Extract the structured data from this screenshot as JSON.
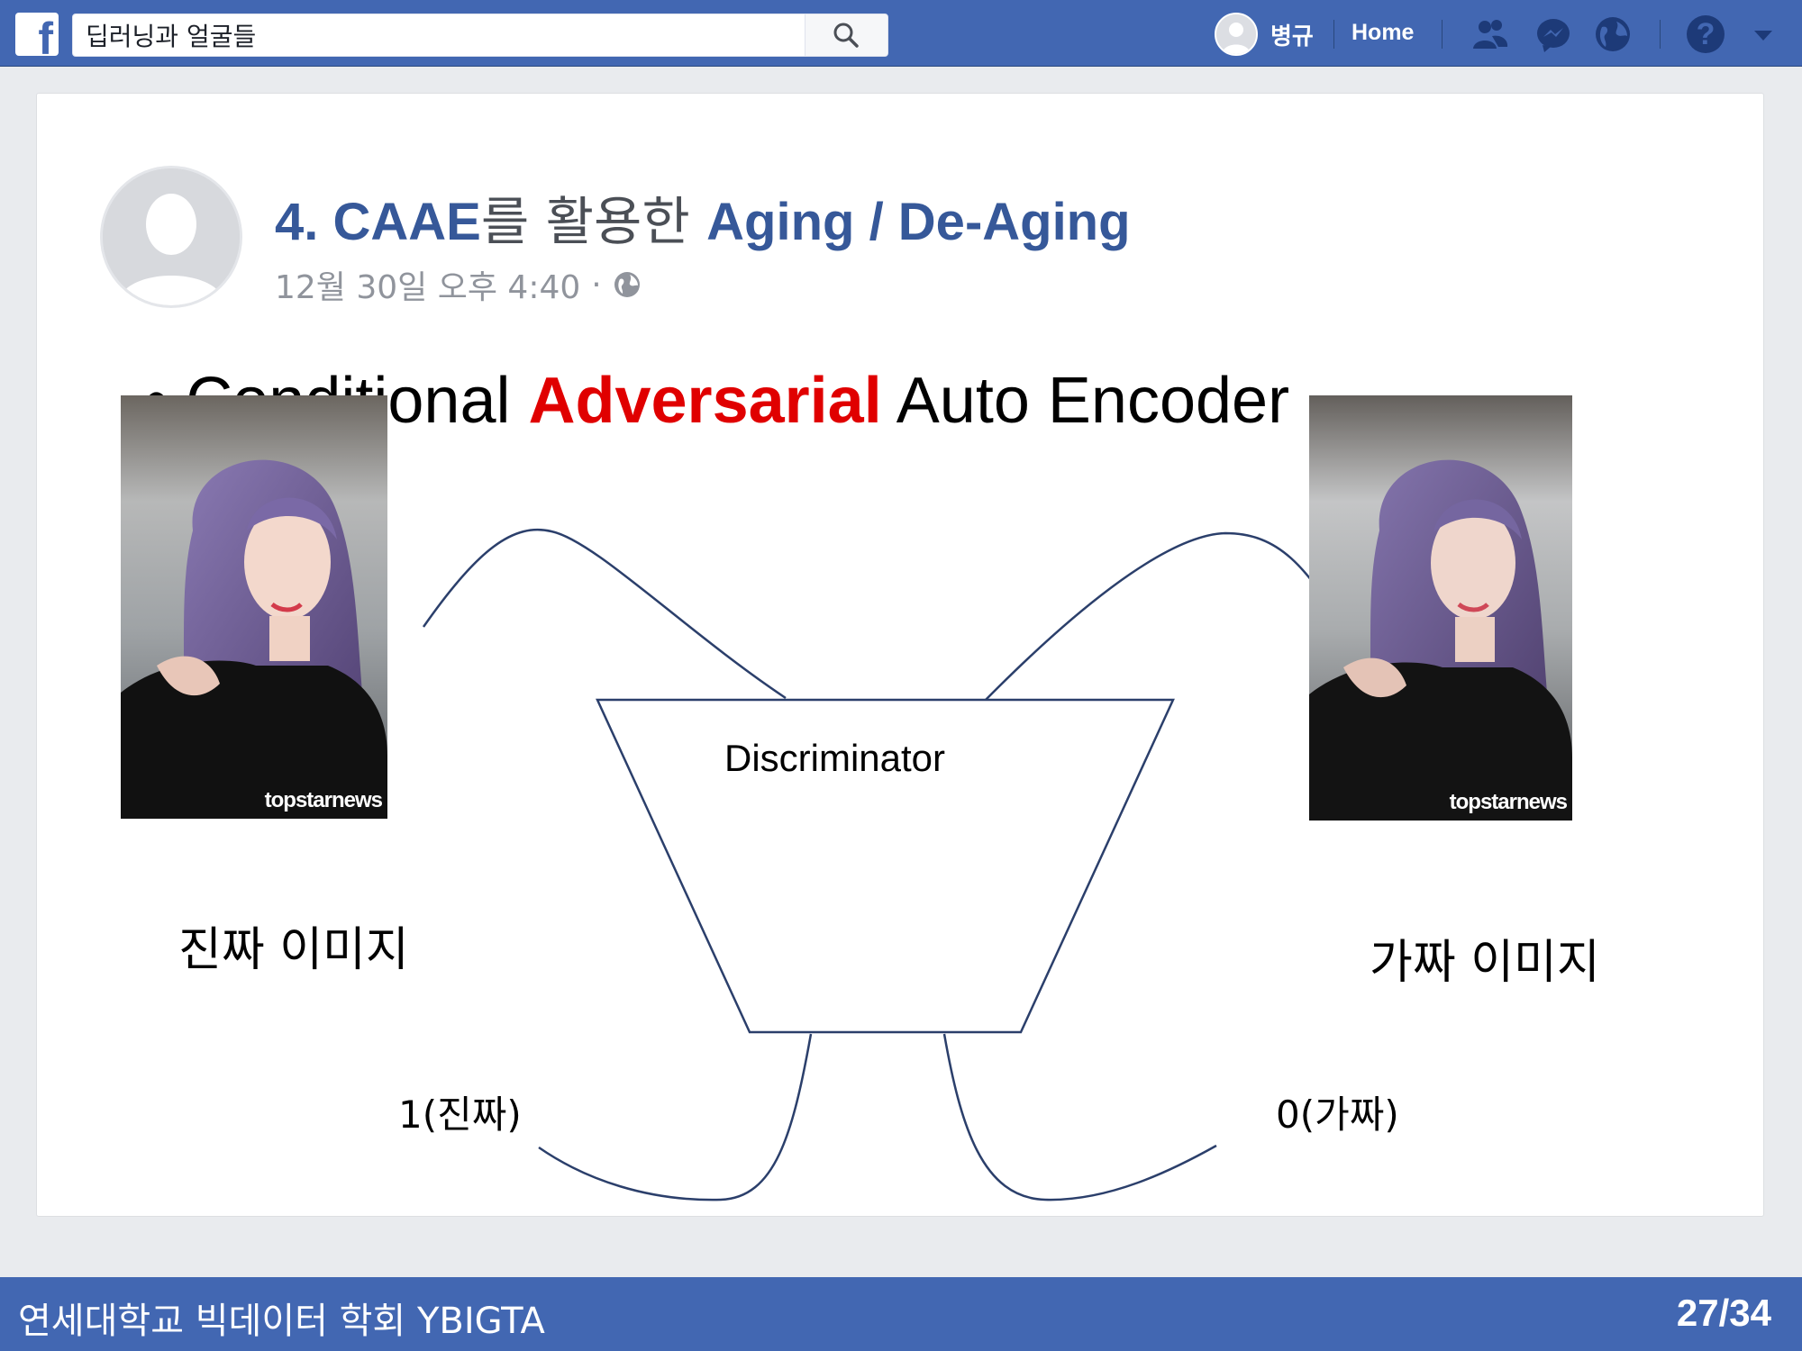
{
  "topbar": {
    "logo": "f",
    "search_value": "딥러닝과 얼굴들",
    "profile_name": "병규",
    "home_label": "Home",
    "icons": [
      "friends-icon",
      "messenger-icon",
      "globe-notifications-icon",
      "help-icon",
      "caret-down-icon"
    ],
    "help_glyph": "?"
  },
  "post": {
    "title_number": "4. ",
    "title_caae": "CAAE",
    "title_mid": "를 활용한 ",
    "title_aging": "Aging / De-Aging",
    "timestamp": "12월 30일 오후 4:40",
    "meta_dot": "·"
  },
  "slide": {
    "bullet_mark": "•",
    "bullet_before": "Conditional ",
    "bullet_highlight": "Adversarial",
    "bullet_after": " Auto Encoder",
    "real_caption": "진짜 이미지",
    "fake_caption": "가짜 이미지",
    "real_watermark": "topstarnews",
    "fake_watermark": "topstarnews",
    "discriminator_label": "Discriminator",
    "real_output": "1(진짜)",
    "fake_output": "0(가짜)"
  },
  "footer": {
    "org": "연세대학교 빅데이터 학회 YBIGTA",
    "page": "27/34"
  },
  "colors": {
    "brand_blue": "#4267b2",
    "title_blue": "#365899",
    "highlight_red": "#e00000",
    "line_navy": "#2b3f6b"
  }
}
